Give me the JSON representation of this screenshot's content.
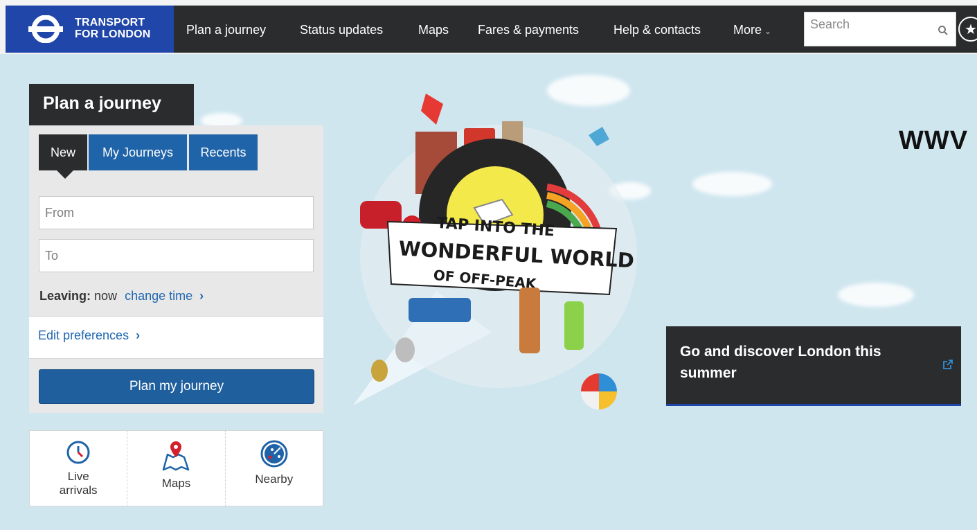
{
  "brand": {
    "line1": "TRANSPORT",
    "line2": "FOR LONDON",
    "accent": "#1f46a8"
  },
  "nav": {
    "items": [
      "Plan a journey",
      "Status updates",
      "Maps",
      "Fares & payments",
      "Help & contacts"
    ],
    "more_label": "More",
    "search_placeholder": "Search",
    "icons": {
      "search": "search-icon",
      "favourite": "star-icon"
    }
  },
  "hero": {
    "url_text": "WWV",
    "banner_line1": "TAP INTO THE",
    "banner_line2": "WONDERFUL WORLD",
    "banner_line3": "OF OFF-PEAK"
  },
  "journey": {
    "title": "Plan a journey",
    "tabs": [
      "New",
      "My Journeys",
      "Recents"
    ],
    "from_placeholder": "From",
    "to_placeholder": "To",
    "leaving_label": "Leaving:",
    "leaving_value": "now",
    "change_time": "change time",
    "edit_preferences": "Edit preferences",
    "plan_button": "Plan my journey",
    "button_color": "#1f5f9d"
  },
  "quick_links": [
    {
      "label_1": "Live",
      "label_2": "arrivals",
      "icon": "clock-icon"
    },
    {
      "label": "Maps",
      "icon": "map-pin-icon"
    },
    {
      "label": "Nearby",
      "icon": "radar-icon"
    }
  ],
  "promo": {
    "text": "Go and discover London this summer",
    "icon": "external-link-icon"
  }
}
